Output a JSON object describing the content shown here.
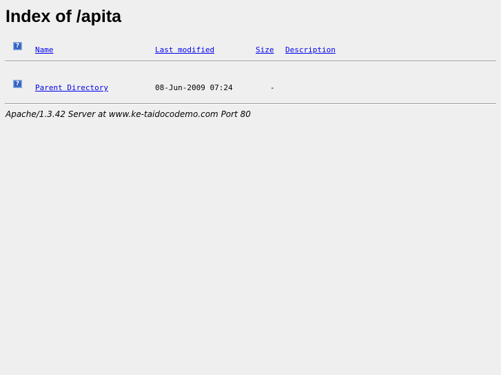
{
  "page": {
    "title": "Index of /apita"
  },
  "listing": {
    "columns": {
      "name": "Name",
      "last_modified": "Last modified",
      "size": "Size",
      "description": "Description"
    },
    "header_icon": {
      "icon": "blank-icon",
      "glyph": "?"
    },
    "rows": [
      {
        "icon": "back-icon",
        "glyph": "?",
        "name": "Parent Directory",
        "last_modified": "08-Jun-2009 07:24",
        "size": "-",
        "description": ""
      }
    ]
  },
  "footer": {
    "address": "Apache/1.3.42 Server at www.ke-taidocodemo.com Port 80"
  }
}
